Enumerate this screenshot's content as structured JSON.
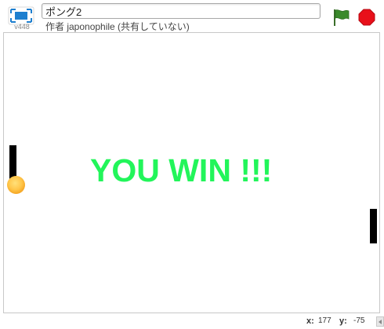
{
  "header": {
    "project_title": "ポング2",
    "author_line": "作者 japonophile (共有していない)",
    "version": "v448",
    "fullscreen_icon": "fullscreen-icon",
    "green_flag_icon": "green-flag-icon",
    "stop_icon": "stop-icon",
    "colors": {
      "fullscreen": "#1e7fcf",
      "green_flag": "#3a8a2b",
      "stop": "#e8101a"
    }
  },
  "stage": {
    "message": "YOU WIN !!!",
    "message_color": "#22f55a",
    "background": "#ffffff"
  },
  "footer": {
    "x_label": "x:",
    "x_value": "177",
    "y_label": "y:",
    "y_value": "-75"
  }
}
